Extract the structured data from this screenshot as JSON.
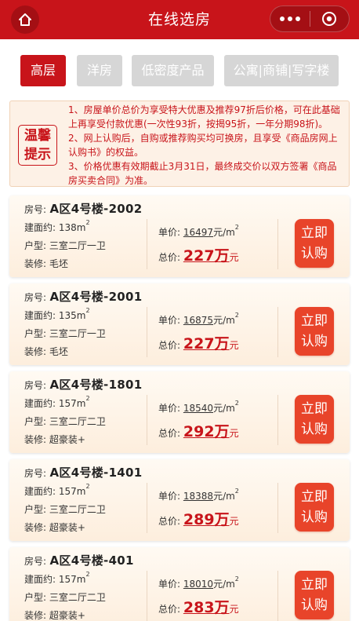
{
  "header": {
    "title": "在线选房",
    "home_icon": "home-icon",
    "more_icon": "more-dots-icon",
    "close_icon": "target-icon",
    "color": "#c8141a"
  },
  "tabs": [
    {
      "label": "高层",
      "active": true
    },
    {
      "label": "洋房",
      "active": false
    },
    {
      "label": "低密度产品",
      "active": false
    },
    {
      "label": "公寓|商铺|写字楼",
      "active": false
    }
  ],
  "notice": {
    "badge_line1": "温馨",
    "badge_line2": "提示",
    "lines": [
      "1、房屋单价总价为享受特大优惠及推荐97折后价格，可在此基础上再享受付款优惠(一次性93折，按揭95折，一年分期98折)。",
      "2、网上认购后，自购或推荐购买均可换房，且享受《商品房网上认购书》的权益。",
      "3、价格优惠有效期截止3月31日，最终成交价以双方签署《商品房买卖合同》为准。"
    ]
  },
  "labels": {
    "room": "房号:",
    "area": "建面约:",
    "type": "户型:",
    "decor": "装修:",
    "unit_price": "单价:",
    "unit_suffix": "元/m",
    "total_price": "总价:",
    "wan": "万",
    "yuan": "元",
    "buy_line1": "立即",
    "buy_line2": "认购",
    "sq": "m",
    "sup2": "2"
  },
  "listings": [
    {
      "room": "A区4号楼-2002",
      "area": "138",
      "layout": "三室二厅一卫",
      "decor": "毛坯",
      "unit_price": "16497",
      "total": "227"
    },
    {
      "room": "A区4号楼-2001",
      "area": "135",
      "layout": "三室二厅一卫",
      "decor": "毛坯",
      "unit_price": "16875",
      "total": "227"
    },
    {
      "room": "A区4号楼-1801",
      "area": "157",
      "layout": "三室二厅二卫",
      "decor": "超豪装+",
      "unit_price": "18540",
      "total": "292"
    },
    {
      "room": "A区4号楼-1401",
      "area": "157",
      "layout": "三室二厅二卫",
      "decor": "超豪装+",
      "unit_price": "18388",
      "total": "289"
    },
    {
      "room": "A区4号楼-401",
      "area": "157",
      "layout": "三室二厅二卫",
      "decor": "超豪装+",
      "unit_price": "18010",
      "total": "283"
    }
  ]
}
